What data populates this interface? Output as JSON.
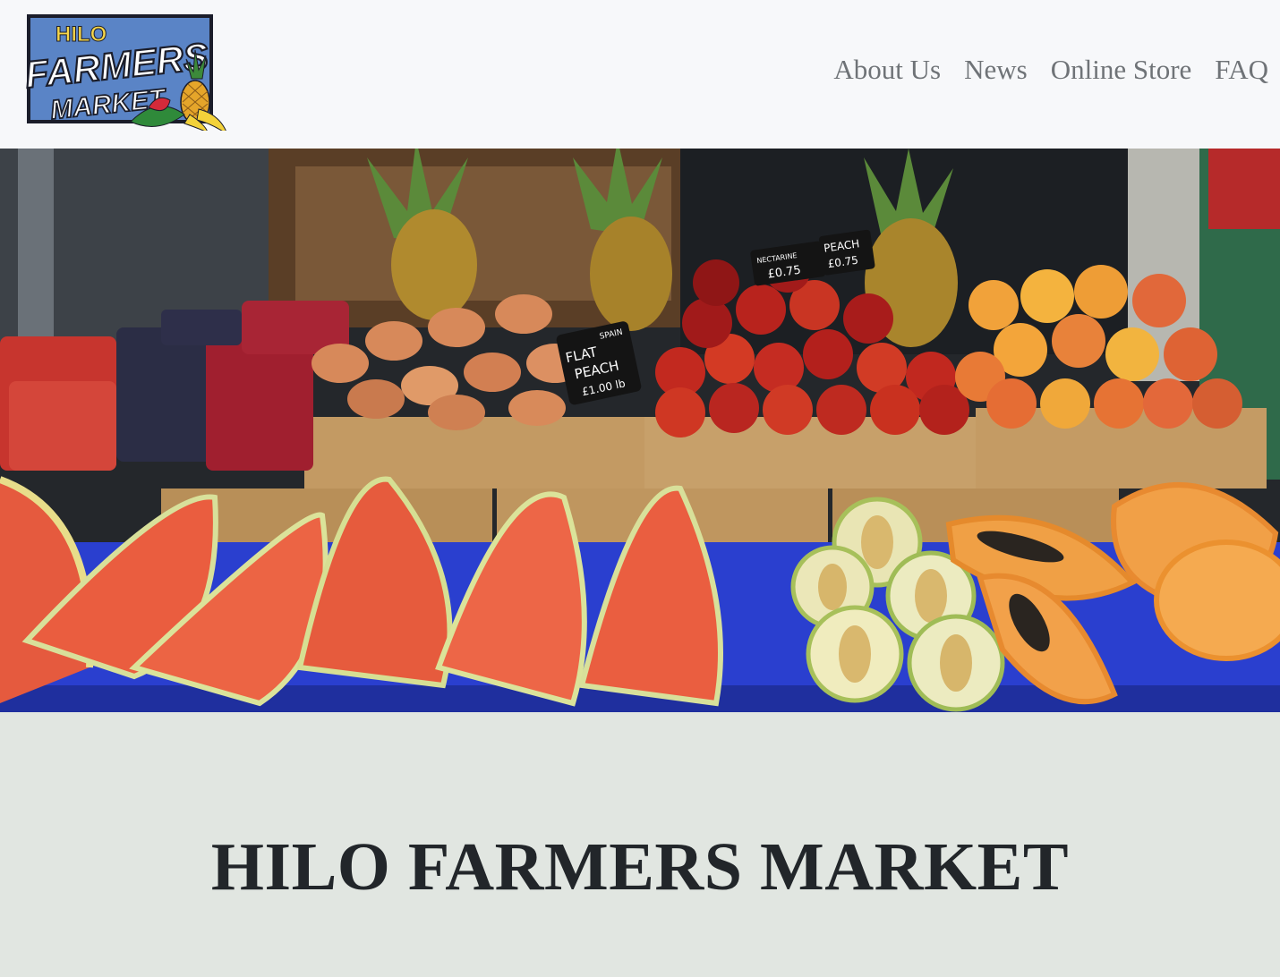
{
  "logo": {
    "line1": "HILO",
    "line2": "FARMERS",
    "line3": "MARKET",
    "colors": {
      "panel": "#5a84c6",
      "yellow": "#f6d64a",
      "white": "#ffffff",
      "outline": "#1b1d2a"
    }
  },
  "nav": {
    "links": [
      {
        "label": "About Us"
      },
      {
        "label": "News"
      },
      {
        "label": "Online Store"
      },
      {
        "label": "FAQ"
      }
    ]
  },
  "hero": {
    "image": "fruit-stand-photo",
    "signs": {
      "flat_peach": {
        "origin": "SPAIN",
        "line1": "FLAT",
        "line2": "PEACH",
        "price": "£1.00 lb"
      },
      "nectarine": {
        "label": "NECTARINE",
        "price": "£0.75"
      },
      "peach": {
        "label": "PEACH",
        "price": "£0.75"
      }
    }
  },
  "main": {
    "title": "HILO FARMERS MARKET"
  }
}
